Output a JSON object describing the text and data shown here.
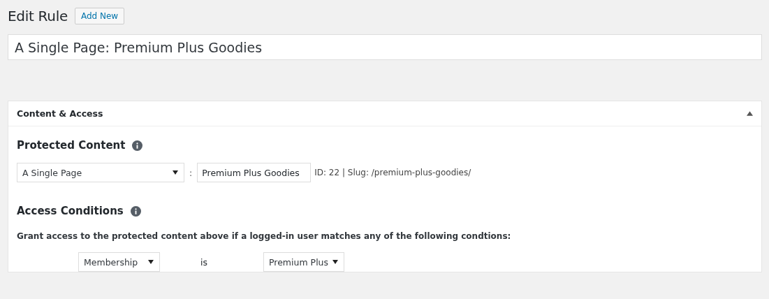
{
  "page_title": "Edit Rule",
  "add_new_button": "Add New",
  "rule_title": "A Single Page: Premium Plus Goodies",
  "panel": {
    "title": "Content & Access",
    "expanded": true,
    "protected_content": {
      "heading": "Protected Content",
      "type_select": "A Single Page",
      "separator": ":",
      "item_value": "Premium Plus Goodies",
      "info": "ID: 22 | Slug: /premium-plus-goodies/"
    },
    "access_conditions": {
      "heading": "Access Conditions",
      "description": "Grant access to the protected content above if a logged-in user matches any of the following condtions:",
      "conditions": [
        {
          "field": "Membership",
          "operator": "is",
          "value": "Premium Plus"
        }
      ]
    }
  }
}
